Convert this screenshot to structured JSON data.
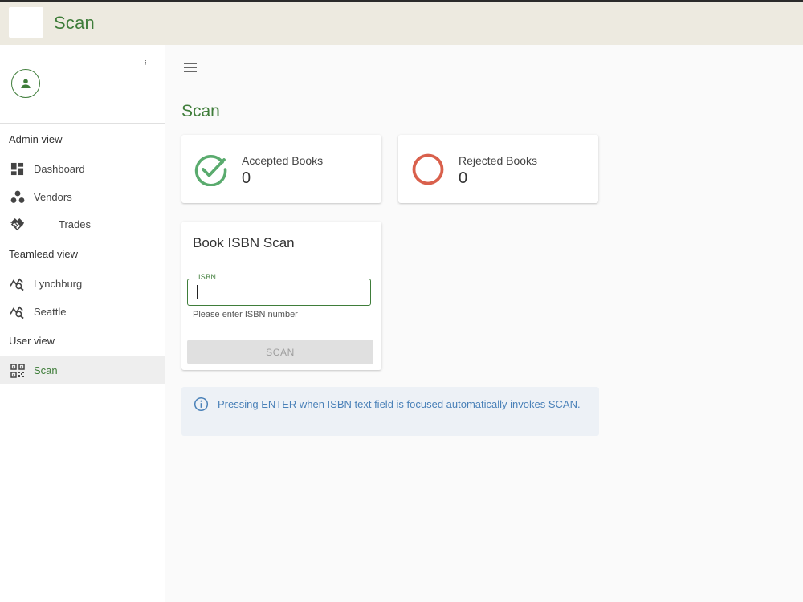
{
  "app": {
    "title": "Scan"
  },
  "sidebar": {
    "menu_glyph": "⁝",
    "sections": [
      {
        "label": "Admin view"
      },
      {
        "label": "Teamlead view"
      },
      {
        "label": "User view"
      }
    ],
    "items": [
      {
        "label": "Dashboard",
        "icon": "dashboard-icon"
      },
      {
        "label": "Vendors",
        "icon": "vendors-icon"
      },
      {
        "label": "Trades",
        "icon": "handshake-icon"
      },
      {
        "label": "Lynchburg",
        "icon": "insights-icon"
      },
      {
        "label": "Seattle",
        "icon": "insights-icon"
      },
      {
        "label": "Scan",
        "icon": "qr-scan-icon",
        "active": true
      }
    ]
  },
  "main": {
    "title": "Scan",
    "stats": [
      {
        "label": "Accepted Books",
        "value": "0",
        "icon": "check-circle-icon",
        "color": "#5aab6e"
      },
      {
        "label": "Rejected Books",
        "value": "0",
        "icon": "empty-circle-icon",
        "color": "#d9604c"
      }
    ],
    "scan_card": {
      "title": "Book ISBN Scan",
      "field_label": "ISBN",
      "field_value": "",
      "helper_text": "Please enter ISBN number",
      "button_label": "SCAN"
    },
    "info": {
      "text": "Pressing ENTER when ISBN text field is focused automatically invokes SCAN."
    }
  },
  "colors": {
    "accent": "#3f7d3a",
    "topbar": "#edeae0",
    "info": "#4a81b8"
  }
}
